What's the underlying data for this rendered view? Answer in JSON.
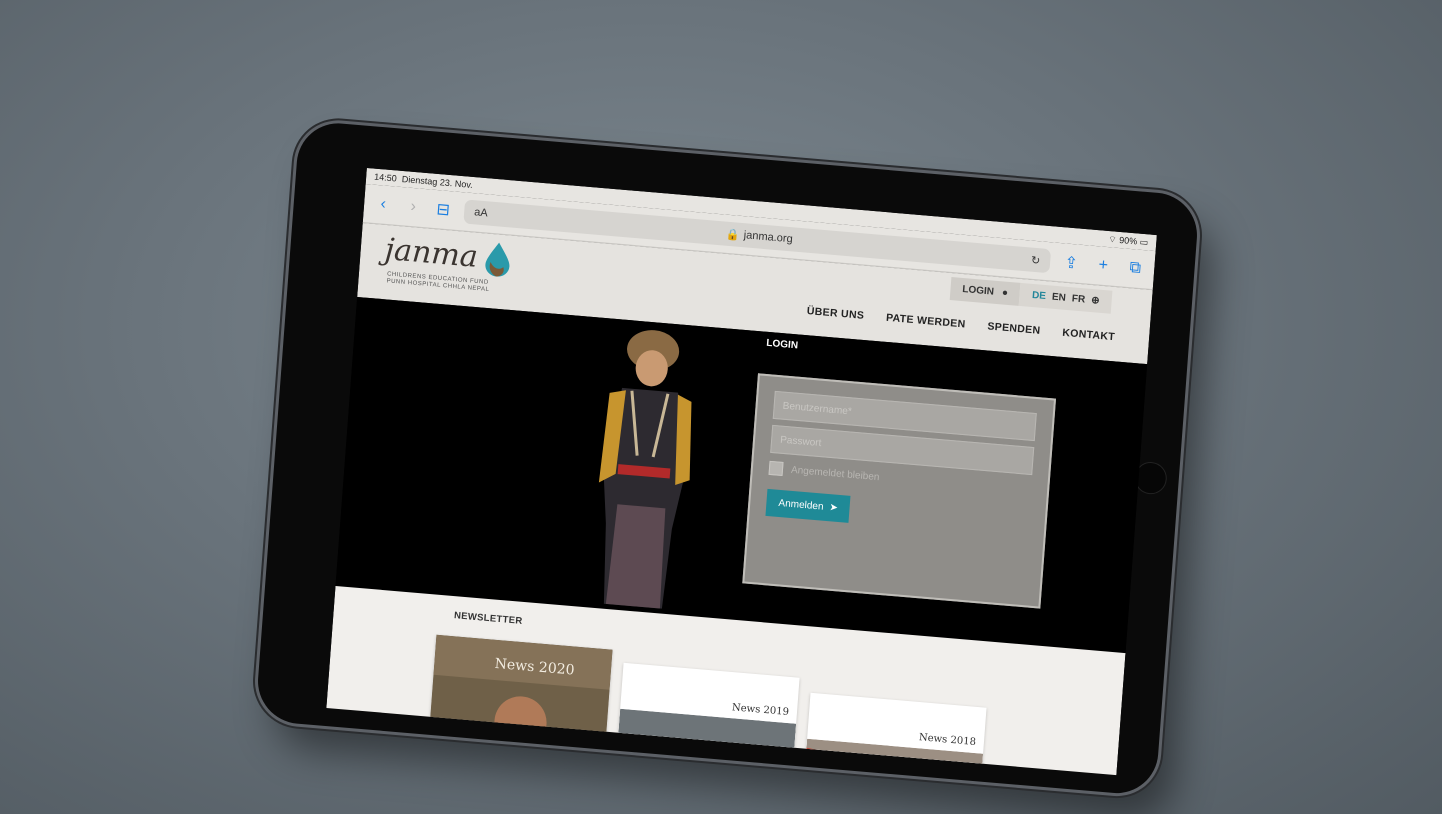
{
  "status": {
    "time": "14:50",
    "date": "Dienstag 23. Nov.",
    "battery": "90%"
  },
  "browser": {
    "url": "janma.org",
    "text_size": "aA"
  },
  "site": {
    "logo_text": "janma",
    "logo_subtitle_1": "CHILDRENS EDUCATION FUND",
    "logo_subtitle_2": "PUNN HOSPITAL CHHLA NEPAL",
    "login_label": "LOGIN",
    "languages": [
      "DE",
      "EN",
      "FR"
    ],
    "nav": [
      "ÜBER UNS",
      "PATE WERDEN",
      "SPENDEN",
      "KONTAKT"
    ]
  },
  "login_form": {
    "title": "LOGIN",
    "username_placeholder": "Benutzername*",
    "password_placeholder": "Passwort",
    "remember_label": "Angemeldet bleiben",
    "submit_label": "Anmelden"
  },
  "newsletter": {
    "title": "NEWSLETTER",
    "items": [
      "News 2020",
      "News 2019",
      "News 2018"
    ]
  },
  "colors": {
    "accent": "#1f8a97",
    "active_language": "#23869a"
  }
}
